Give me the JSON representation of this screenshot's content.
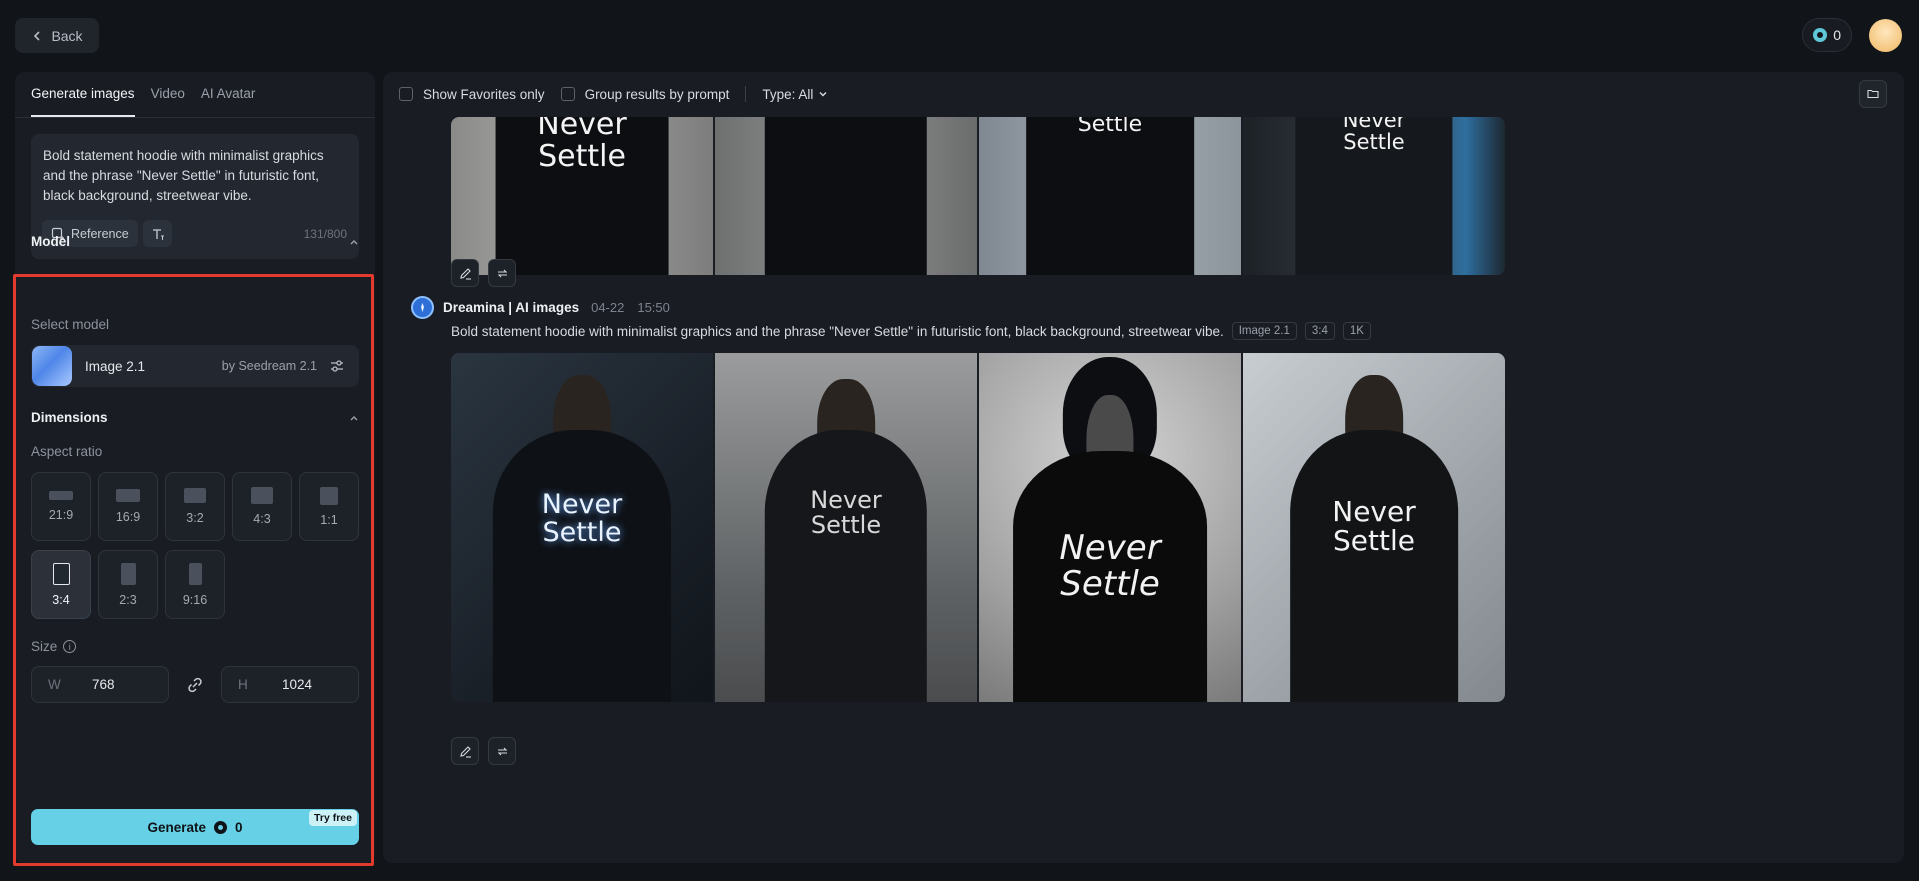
{
  "topbar": {
    "back_label": "Back",
    "credits": "0"
  },
  "left": {
    "tabs": [
      {
        "label": "Generate images",
        "active": true
      },
      {
        "label": "Video",
        "active": false
      },
      {
        "label": "AI Avatar",
        "active": false
      }
    ],
    "prompt": {
      "text": "Bold statement hoodie with minimalist graphics and the phrase \"Never Settle\" in futuristic font, black background, streetwear vibe.",
      "reference_label": "Reference",
      "char_count": "131/800"
    },
    "model_section": {
      "title": "Model",
      "select_label": "Select model",
      "model_name": "Image 2.1",
      "model_by": "by Seedream 2.1"
    },
    "dimensions_section": {
      "title": "Dimensions",
      "aspect_label": "Aspect ratio",
      "ratios": [
        {
          "label": "21:9",
          "selected": false
        },
        {
          "label": "16:9",
          "selected": false
        },
        {
          "label": "3:2",
          "selected": false
        },
        {
          "label": "4:3",
          "selected": false
        },
        {
          "label": "1:1",
          "selected": false
        },
        {
          "label": "3:4",
          "selected": true
        },
        {
          "label": "2:3",
          "selected": false
        },
        {
          "label": "9:16",
          "selected": false
        }
      ],
      "size_label": "Size",
      "width_prefix": "W",
      "width_value": "768",
      "height_prefix": "H",
      "height_value": "1024"
    },
    "generate": {
      "label": "Generate",
      "cost": "0",
      "badge": "Try free"
    }
  },
  "main": {
    "filters": {
      "favorites_label": "Show Favorites only",
      "group_label": "Group results by prompt",
      "type_label": "Type: All"
    },
    "top_batch": {
      "shirt_texts": [
        "Never\nSettle",
        "",
        "Settle",
        "Never\nSettle"
      ]
    },
    "generation": {
      "source": "Dreamina | AI images",
      "date": "04-22",
      "time": "15:50",
      "prompt": "Bold statement hoodie with minimalist graphics and the phrase \"Never Settle\" in futuristic font, black background, streetwear vibe.",
      "tags": [
        "Image 2.1",
        "3:4",
        "1K"
      ],
      "shirt_texts": [
        "Never\nSettle",
        "Never\nSettle",
        "Never\nSettle",
        "Never\nSettle"
      ]
    }
  },
  "colors": {
    "accent": "#66d1e6",
    "highlight": "#e23b2e",
    "background": "#111418",
    "panel": "#191d23"
  }
}
